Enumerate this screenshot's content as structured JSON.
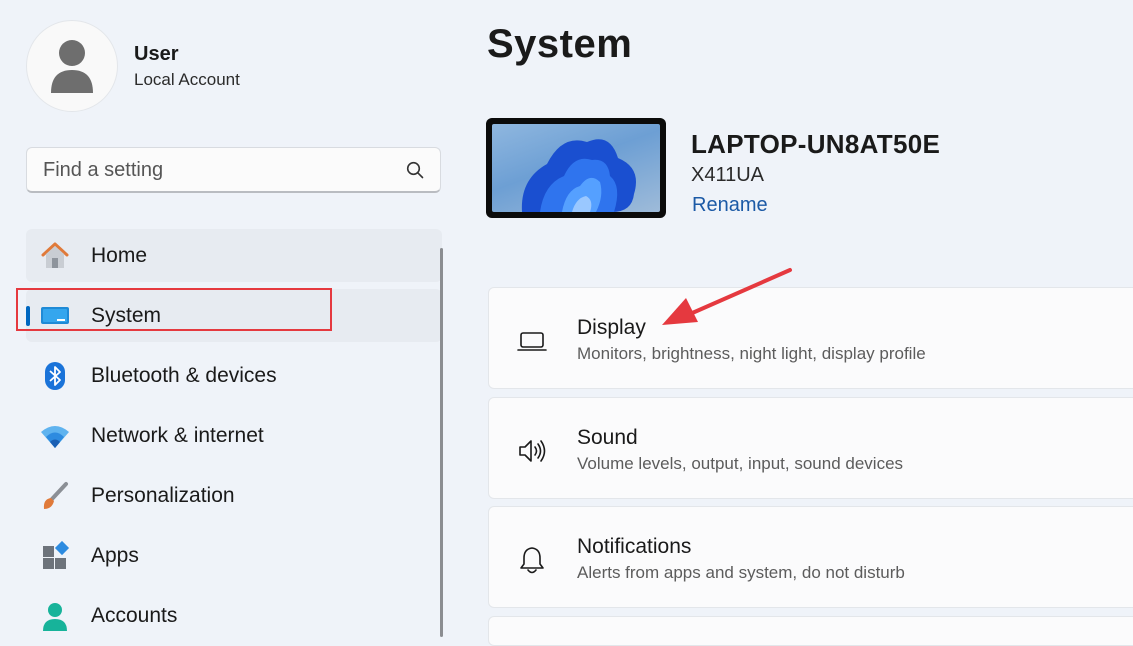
{
  "profile": {
    "name": "User",
    "account_type": "Local Account",
    "avatar_icon": "person-silhouette"
  },
  "search": {
    "placeholder": "Find a setting",
    "icon": "search-icon"
  },
  "sidebar": {
    "selected": "System",
    "items": [
      {
        "label": "Home",
        "icon": "home-icon"
      },
      {
        "label": "System",
        "icon": "system-display-icon"
      },
      {
        "label": "Bluetooth & devices",
        "icon": "bluetooth-icon"
      },
      {
        "label": "Network & internet",
        "icon": "wifi-icon"
      },
      {
        "label": "Personalization",
        "icon": "paintbrush-icon"
      },
      {
        "label": "Apps",
        "icon": "apps-icon"
      },
      {
        "label": "Accounts",
        "icon": "accounts-icon"
      }
    ]
  },
  "main": {
    "title": "System",
    "device": {
      "name": "LAPTOP-UN8AT50E",
      "model": "X411UA",
      "rename_label": "Rename"
    },
    "cards": [
      {
        "title": "Display",
        "description": "Monitors, brightness, night light, display profile",
        "icon": "laptop-icon"
      },
      {
        "title": "Sound",
        "description": "Volume levels, output, input, sound devices",
        "icon": "speaker-icon"
      },
      {
        "title": "Notifications",
        "description": "Alerts from apps and system, do not disturb",
        "icon": "bell-icon"
      }
    ]
  },
  "colors": {
    "accent": "#0067c0",
    "annotation_red": "#e5393f",
    "background": "#eff3f9",
    "link": "#1c5aa6"
  }
}
